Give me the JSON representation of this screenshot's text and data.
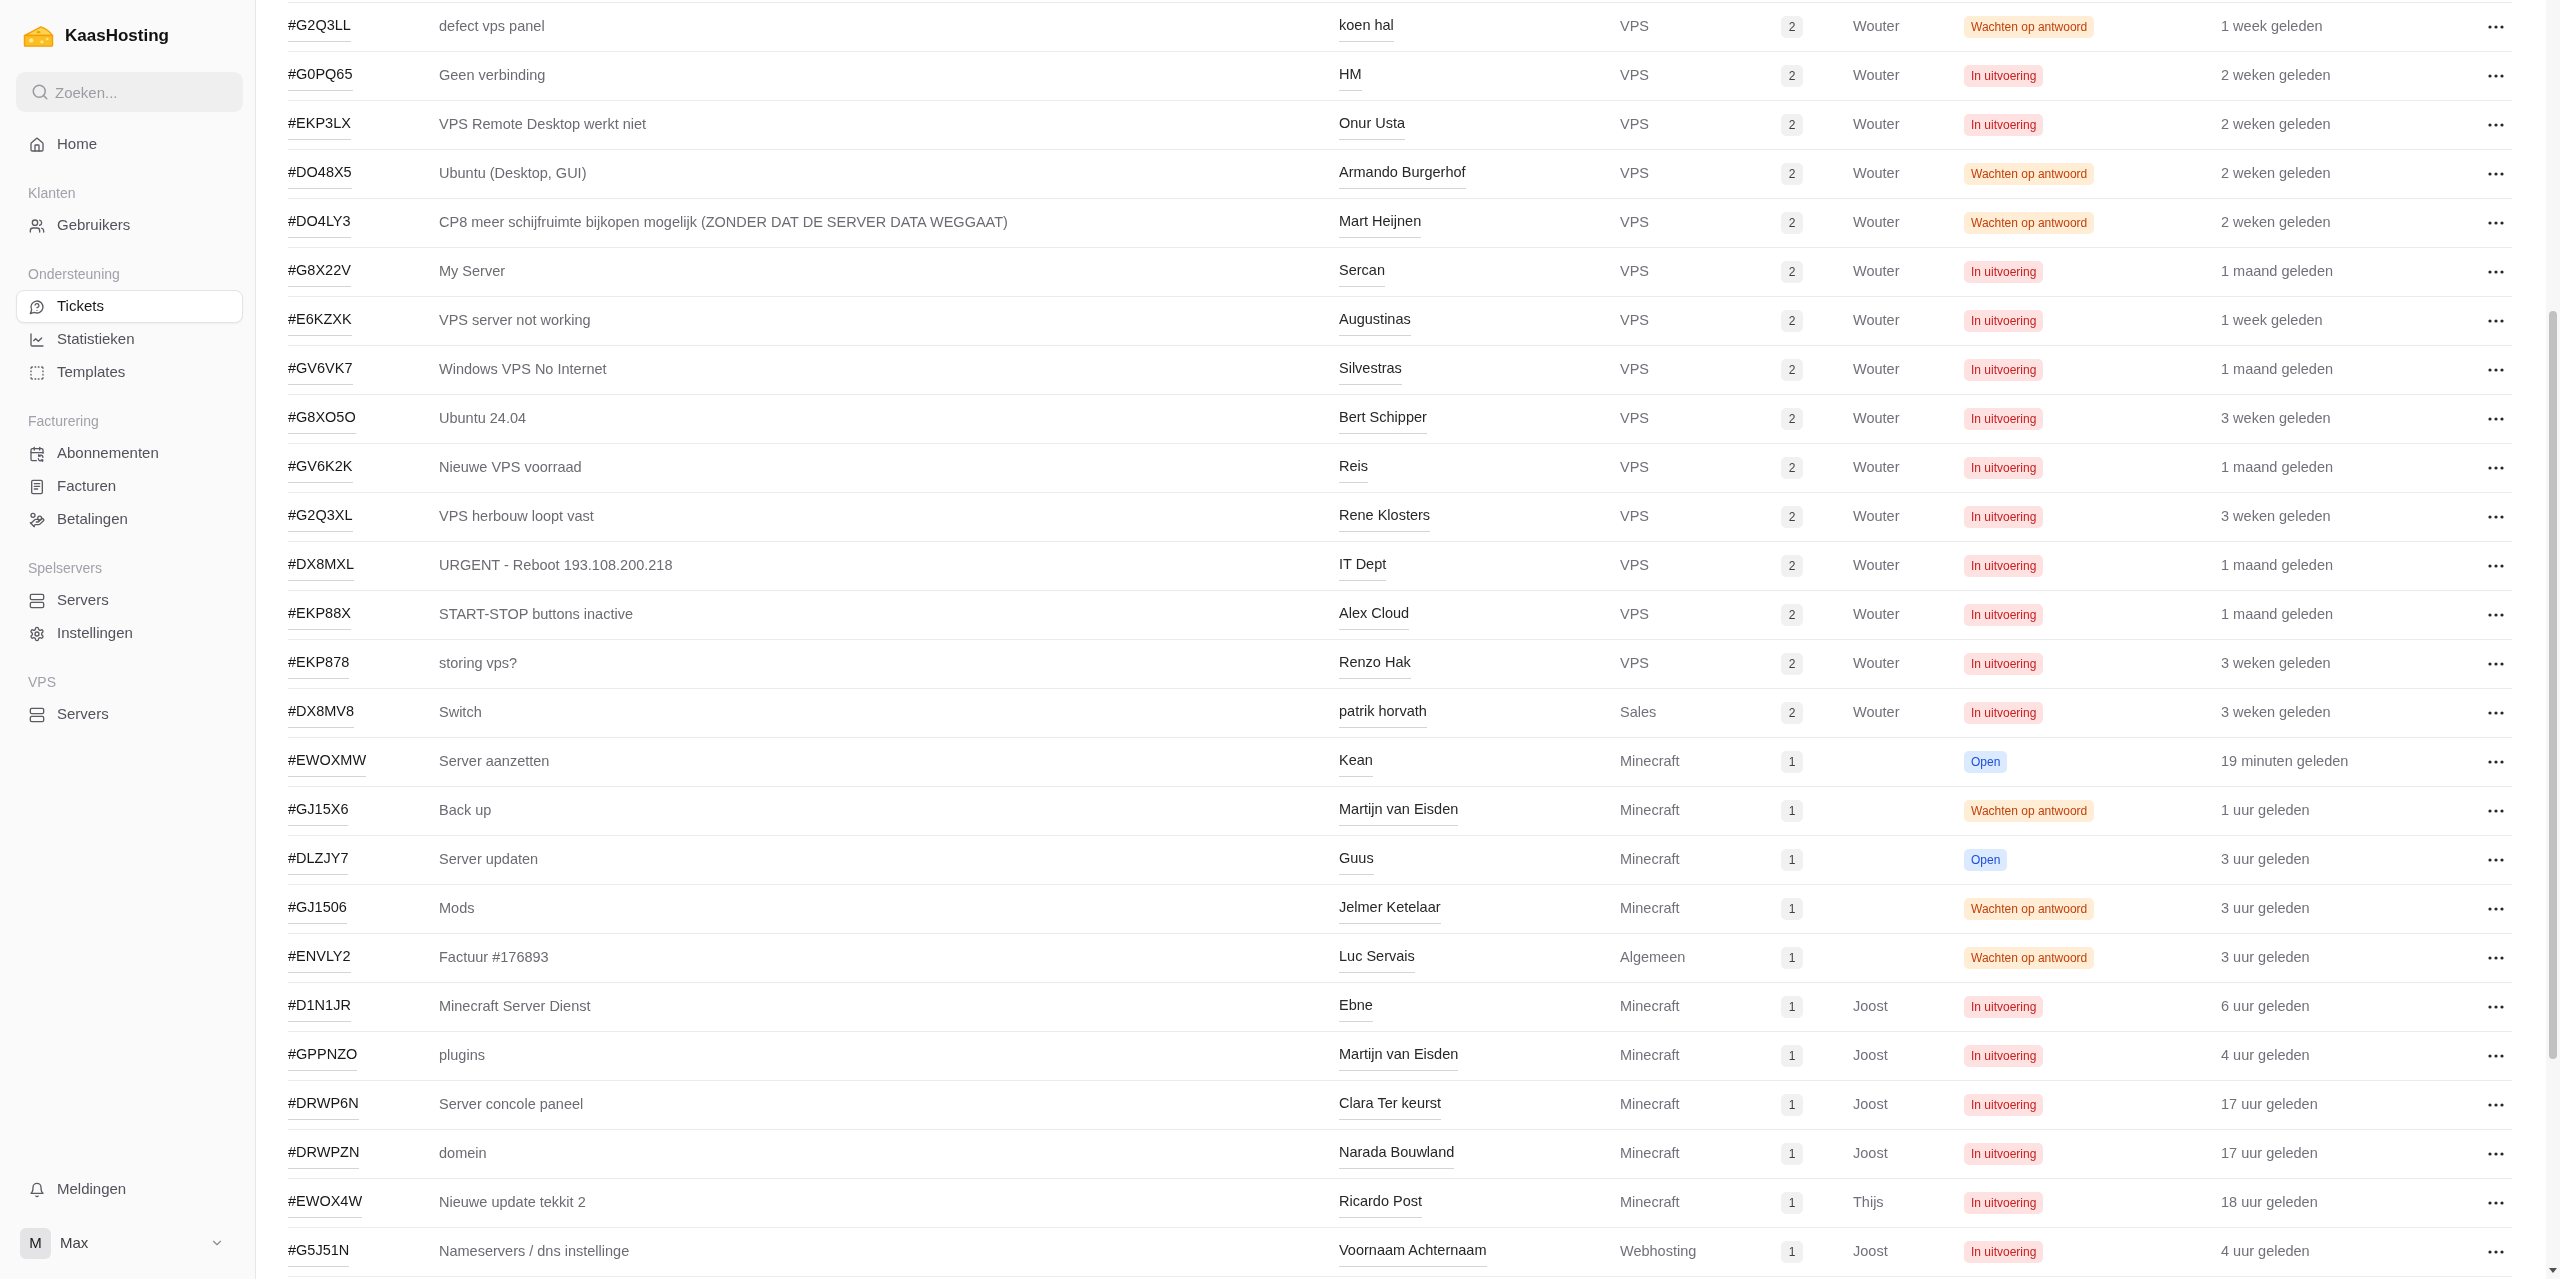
{
  "sidebar": {
    "brand": "KaasHosting",
    "search": {
      "placeholder": "Zoeken..."
    },
    "groups": [
      {
        "items": [
          {
            "label": "Home",
            "selected": false
          }
        ]
      },
      {
        "title": "Klanten",
        "items": [
          {
            "label": "Gebruikers",
            "selected": false
          }
        ]
      },
      {
        "title": "Ondersteuning",
        "items": [
          {
            "label": "Tickets",
            "selected": true
          },
          {
            "label": "Statistieken",
            "selected": false
          },
          {
            "label": "Templates",
            "selected": false
          }
        ]
      },
      {
        "title": "Facturering",
        "items": [
          {
            "label": "Abonnementen",
            "selected": false
          },
          {
            "label": "Facturen",
            "selected": false
          },
          {
            "label": "Betalingen",
            "selected": false
          }
        ]
      },
      {
        "title": "Spelservers",
        "items": [
          {
            "label": "Servers",
            "selected": false
          },
          {
            "label": "Instellingen",
            "selected": false
          }
        ]
      },
      {
        "title": "VPS",
        "items": [
          {
            "label": "Servers",
            "selected": false
          }
        ]
      }
    ],
    "footer": {
      "notifications": "Meldingen",
      "user": {
        "initial": "M",
        "name": "Max"
      }
    }
  },
  "tickets": {
    "rows": [
      {
        "ticket": "#G2Q3LL",
        "subject": "defect vps panel",
        "name": "koen hal",
        "category": "VPS",
        "column_5": "2",
        "column_6": "Wouter",
        "status": {
          "label": "Wachten op antwoord",
          "kind": "waiting"
        },
        "age": "1 week geleden"
      },
      {
        "ticket": "#G0PQ65",
        "subject": "Geen verbinding",
        "name": "HM",
        "category": "VPS",
        "column_5": "2",
        "column_6": "Wouter",
        "status": {
          "label": "In uitvoering",
          "kind": "in_progress"
        },
        "age": "2 weken geleden"
      },
      {
        "ticket": "#EKP3LX",
        "subject": "VPS Remote Desktop werkt niet",
        "name": "Onur Usta",
        "category": "VPS",
        "column_5": "2",
        "column_6": "Wouter",
        "status": {
          "label": "In uitvoering",
          "kind": "in_progress"
        },
        "age": "2 weken geleden"
      },
      {
        "ticket": "#DO48X5",
        "subject": "Ubuntu (Desktop, GUI)",
        "name": "Armando Burgerhof",
        "category": "VPS",
        "column_5": "2",
        "column_6": "Wouter",
        "status": {
          "label": "Wachten op antwoord",
          "kind": "waiting"
        },
        "age": "2 weken geleden"
      },
      {
        "ticket": "#DO4LY3",
        "subject": "CP8 meer schijfruimte bijkopen mogelijk (ZONDER DAT DE SERVER DATA WEGGAAT)",
        "name": "Mart Heijnen",
        "category": "VPS",
        "column_5": "2",
        "column_6": "Wouter",
        "status": {
          "label": "Wachten op antwoord",
          "kind": "waiting"
        },
        "age": "2 weken geleden"
      },
      {
        "ticket": "#G8X22V",
        "subject": "My Server",
        "name": "Sercan",
        "category": "VPS",
        "column_5": "2",
        "column_6": "Wouter",
        "status": {
          "label": "In uitvoering",
          "kind": "in_progress"
        },
        "age": "1 maand geleden"
      },
      {
        "ticket": "#E6KZXK",
        "subject": "VPS server not working",
        "name": "Augustinas",
        "category": "VPS",
        "column_5": "2",
        "column_6": "Wouter",
        "status": {
          "label": "In uitvoering",
          "kind": "in_progress"
        },
        "age": "1 week geleden"
      },
      {
        "ticket": "#GV6VK7",
        "subject": "Windows VPS No Internet",
        "name": "Silvestras",
        "category": "VPS",
        "column_5": "2",
        "column_6": "Wouter",
        "status": {
          "label": "In uitvoering",
          "kind": "in_progress"
        },
        "age": "1 maand geleden"
      },
      {
        "ticket": "#G8XO5O",
        "subject": "Ubuntu 24.04",
        "name": "Bert Schipper",
        "category": "VPS",
        "column_5": "2",
        "column_6": "Wouter",
        "status": {
          "label": "In uitvoering",
          "kind": "in_progress"
        },
        "age": "3 weken geleden"
      },
      {
        "ticket": "#GV6K2K",
        "subject": "Nieuwe VPS voorraad",
        "name": "Reis",
        "category": "VPS",
        "column_5": "2",
        "column_6": "Wouter",
        "status": {
          "label": "In uitvoering",
          "kind": "in_progress"
        },
        "age": "1 maand geleden"
      },
      {
        "ticket": "#G2Q3XL",
        "subject": "VPS herbouw loopt vast",
        "name": "Rene Klosters",
        "category": "VPS",
        "column_5": "2",
        "column_6": "Wouter",
        "status": {
          "label": "In uitvoering",
          "kind": "in_progress"
        },
        "age": "3 weken geleden"
      },
      {
        "ticket": "#DX8MXL",
        "subject": "URGENT - Reboot 193.108.200.218",
        "name": "IT Dept",
        "category": "VPS",
        "column_5": "2",
        "column_6": "Wouter",
        "status": {
          "label": "In uitvoering",
          "kind": "in_progress"
        },
        "age": "1 maand geleden"
      },
      {
        "ticket": "#EKP88X",
        "subject": "START-STOP buttons inactive",
        "name": "Alex Cloud",
        "category": "VPS",
        "column_5": "2",
        "column_6": "Wouter",
        "status": {
          "label": "In uitvoering",
          "kind": "in_progress"
        },
        "age": "1 maand geleden"
      },
      {
        "ticket": "#EKP878",
        "subject": "storing vps?",
        "name": "Renzo Hak",
        "category": "VPS",
        "column_5": "2",
        "column_6": "Wouter",
        "status": {
          "label": "In uitvoering",
          "kind": "in_progress"
        },
        "age": "3 weken geleden"
      },
      {
        "ticket": "#DX8MV8",
        "subject": "Switch",
        "name": "patrik horvath",
        "category": "Sales",
        "column_5": "2",
        "column_6": "Wouter",
        "status": {
          "label": "In uitvoering",
          "kind": "in_progress"
        },
        "age": "3 weken geleden"
      },
      {
        "ticket": "#EWOXMW",
        "subject": "Server aanzetten",
        "name": "Kean",
        "category": "Minecraft",
        "column_5": "1",
        "status": {
          "label": "Open",
          "kind": "open"
        },
        "age": "19 minuten geleden"
      },
      {
        "ticket": "#GJ15X6",
        "subject": "Back up",
        "name": "Martijn van Eisden",
        "category": "Minecraft",
        "column_5": "1",
        "status": {
          "label": "Wachten op antwoord",
          "kind": "waiting"
        },
        "age": "1 uur geleden"
      },
      {
        "ticket": "#DLZJY7",
        "subject": "Server updaten",
        "name": "Guus",
        "category": "Minecraft",
        "column_5": "1",
        "status": {
          "label": "Open",
          "kind": "open"
        },
        "age": "3 uur geleden"
      },
      {
        "ticket": "#GJ1506",
        "subject": "Mods",
        "name": "Jelmer Ketelaar",
        "category": "Minecraft",
        "column_5": "1",
        "status": {
          "label": "Wachten op antwoord",
          "kind": "waiting"
        },
        "age": "3 uur geleden"
      },
      {
        "ticket": "#ENVLY2",
        "subject": "Factuur #176893",
        "name": "Luc Servais",
        "category": "Algemeen",
        "column_5": "1",
        "status": {
          "label": "Wachten op antwoord",
          "kind": "waiting"
        },
        "age": "3 uur geleden"
      },
      {
        "ticket": "#D1N1JR",
        "subject": "Minecraft Server Dienst",
        "name": "Ebne",
        "category": "Minecraft",
        "column_5": "1",
        "column_6": "Joost",
        "status": {
          "label": "In uitvoering",
          "kind": "in_progress"
        },
        "age": "6 uur geleden"
      },
      {
        "ticket": "#GPPNZO",
        "subject": "plugins",
        "name": "Martijn van Eisden",
        "category": "Minecraft",
        "column_5": "1",
        "column_6": "Joost",
        "status": {
          "label": "In uitvoering",
          "kind": "in_progress"
        },
        "age": "4 uur geleden"
      },
      {
        "ticket": "#DRWP6N",
        "subject": "Server concole paneel",
        "name": "Clara Ter keurst",
        "category": "Minecraft",
        "column_5": "1",
        "column_6": "Joost",
        "status": {
          "label": "In uitvoering",
          "kind": "in_progress"
        },
        "age": "17 uur geleden"
      },
      {
        "ticket": "#DRWPZN",
        "subject": "domein",
        "name": "Narada Bouwland",
        "category": "Minecraft",
        "column_5": "1",
        "column_6": "Joost",
        "status": {
          "label": "In uitvoering",
          "kind": "in_progress"
        },
        "age": "17 uur geleden"
      },
      {
        "ticket": "#EWOX4W",
        "subject": "Nieuwe update tekkit 2",
        "name": "Ricardo Post",
        "category": "Minecraft",
        "column_5": "1",
        "column_6": "Thijs",
        "status": {
          "label": "In uitvoering",
          "kind": "in_progress"
        },
        "age": "18 uur geleden"
      },
      {
        "ticket": "#G5J51N",
        "subject": "Nameservers / dns instellinge",
        "name": "Voornaam Achternaam",
        "category": "Webhosting",
        "column_5": "1",
        "column_6": "Joost",
        "status": {
          "label": "In uitvoering",
          "kind": "in_progress"
        },
        "age": "4 uur geleden"
      }
    ]
  }
}
